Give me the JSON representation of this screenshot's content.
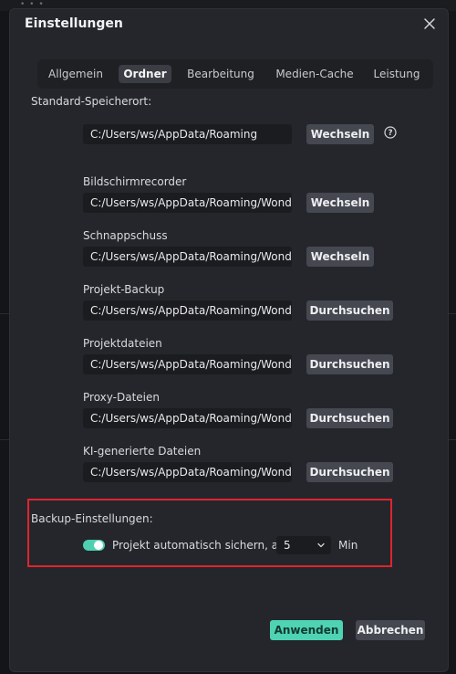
{
  "dialog": {
    "title": "Einstellungen"
  },
  "tabs": [
    {
      "label": "Allgemein",
      "active": false
    },
    {
      "label": "Ordner",
      "active": true
    },
    {
      "label": "Bearbeitung",
      "active": false
    },
    {
      "label": "Medien-Cache",
      "active": false
    },
    {
      "label": "Leistung",
      "active": false
    }
  ],
  "storage": {
    "label": "Standard-Speicherort:",
    "path": "C:/Users/ws/AppData/Roaming",
    "button": "Wechseln"
  },
  "folders": [
    {
      "label": "Bildschirmrecorder",
      "path": "C:/Users/ws/AppData/Roaming/Wonder",
      "button": "Wechseln"
    },
    {
      "label": "Schnappschuss",
      "path": "C:/Users/ws/AppData/Roaming/Wonder",
      "button": "Wechseln"
    },
    {
      "label": "Projekt-Backup",
      "path": "C:/Users/ws/AppData/Roaming/Wonder",
      "button": "Durchsuchen"
    },
    {
      "label": "Projektdateien",
      "path": "C:/Users/ws/AppData/Roaming/Wonder",
      "button": "Durchsuchen"
    },
    {
      "label": "Proxy-Dateien",
      "path": "C:/Users/ws/AppData/Roaming/Wonder",
      "button": "Durchsuchen"
    },
    {
      "label": "KI-generierte Dateien",
      "path": "C:/Users/ws/AppData/Roaming/Wonder",
      "button": "Durchsuchen"
    }
  ],
  "backup": {
    "heading": "Backup-Einstellungen:",
    "toggle_on": true,
    "toggle_label": "Projekt automatisch sichern, alle",
    "interval": "5",
    "unit": "Min"
  },
  "footer": {
    "apply": "Anwenden",
    "cancel": "Abbrechen"
  },
  "colors": {
    "accent": "#4ed3b3",
    "highlight_border": "#e0242f",
    "dialog_bg": "#24262b"
  },
  "icons": {
    "close": "close-icon",
    "help": "help-circle-icon",
    "chevron": "chevron-down-icon"
  }
}
